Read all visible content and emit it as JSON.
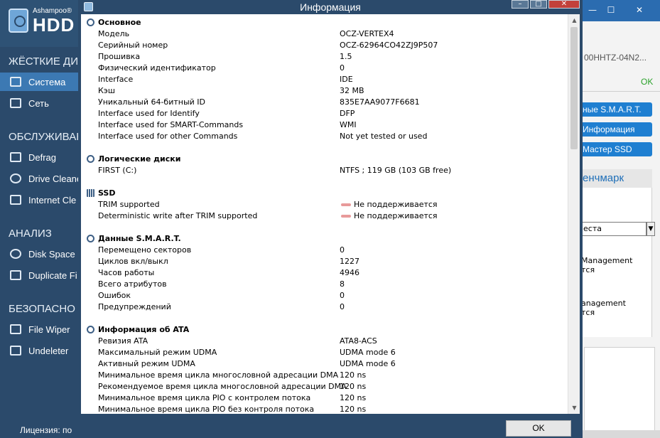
{
  "background": {
    "brand_small": "Ashampoo®",
    "brand_big": "HDD C",
    "sections": [
      {
        "label": "ЖЁСТКИЕ ДИС"
      },
      {
        "label": "ОБСЛУЖИВАН"
      },
      {
        "label": "АНАЛИЗ"
      },
      {
        "label": "БЕЗОПАСНО"
      }
    ],
    "items": [
      {
        "label": "Система",
        "icon": "monitor-icon"
      },
      {
        "label": "Сеть",
        "icon": "network-icon"
      },
      {
        "label": "Defrag",
        "icon": "defrag-icon"
      },
      {
        "label": "Drive Cleane",
        "icon": "drive-cleaner-icon"
      },
      {
        "label": "Internet Cle",
        "icon": "internet-cleaner-icon"
      },
      {
        "label": "Disk Space",
        "icon": "disk-space-icon"
      },
      {
        "label": "Duplicate Fi",
        "icon": "duplicate-icon"
      },
      {
        "label": "File Wiper",
        "icon": "file-wiper-icon"
      },
      {
        "label": "Undeleter",
        "icon": "undeleter-icon"
      }
    ],
    "license": "Лицензия: по",
    "right": {
      "model": "00HHTZ-04N2...",
      "ok": "OK",
      "buttons": [
        "ные S.M.A.R.T.",
        "Информация",
        "Мастер SSD"
      ],
      "bench_header": "енчмарк",
      "select_value": "еста",
      "text1a": "Management",
      "text1b": "тся",
      "text2a": "anagement",
      "text2b": "тся"
    }
  },
  "dialog": {
    "title": "Информация",
    "ok_label": "OK",
    "sections": [
      {
        "title": "Основное",
        "icon": "info-icon",
        "rows": [
          {
            "k": "Модель",
            "v": "OCZ-VERTEX4"
          },
          {
            "k": "Серийный номер",
            "v": "OCZ-62964CO42ZJ9P507"
          },
          {
            "k": "Прошивка",
            "v": "1.5"
          },
          {
            "k": "Физический идентификатор",
            "v": "0"
          },
          {
            "k": "Interface",
            "v": "IDE"
          },
          {
            "k": "Кэш",
            "v": "32 MB"
          },
          {
            "k": "Уникальный 64-битный ID",
            "v": "835E7AA9077F6681"
          },
          {
            "k": "Interface used for Identify",
            "v": "DFP"
          },
          {
            "k": "Interface used for SMART-Commands",
            "v": "WMI"
          },
          {
            "k": "Interface used for other Commands",
            "v": "Not yet tested or used"
          }
        ]
      },
      {
        "title": "Логические диски",
        "icon": "info-icon",
        "rows": [
          {
            "k": "FIRST (C:)",
            "v": "NTFS ; 119 GB (103 GB free)"
          }
        ]
      },
      {
        "title": "SSD",
        "icon": "ssd-icon",
        "rows": [
          {
            "k": "TRIM supported",
            "v": "Не поддерживается",
            "flag": true
          },
          {
            "k": "Deterministic write after TRIM supported",
            "v": "Не поддерживается",
            "flag": true
          }
        ]
      },
      {
        "title": "Данные S.M.A.R.T.",
        "icon": "info-icon",
        "rows": [
          {
            "k": "Перемещено секторов",
            "v": "0"
          },
          {
            "k": "Циклов вкл/выкл",
            "v": "1227"
          },
          {
            "k": "Часов работы",
            "v": "4946"
          },
          {
            "k": "Всего атрибутов",
            "v": "8"
          },
          {
            "k": "Ошибок",
            "v": "0"
          },
          {
            "k": "Предупреждений",
            "v": "0"
          }
        ]
      },
      {
        "title": "Информация об ATA",
        "icon": "info-icon",
        "rows": [
          {
            "k": "Ревизия ATA",
            "v": "ATA8-ACS"
          },
          {
            "k": "Максимальный режим UDMA",
            "v": "UDMA mode 6"
          },
          {
            "k": "Активный режим UDMA",
            "v": "UDMA mode 6"
          },
          {
            "k": "Минимальное время цикла многословной адресации DMA",
            "v": "120 ns"
          },
          {
            "k": "Рекомендуемое время цикла многословной адресации DMA",
            "v": "120 ns"
          },
          {
            "k": "Минимальное время цикла PIO с контролем потока",
            "v": "120 ns"
          },
          {
            "k": "Минимальное время цикла PIO без контроля потока",
            "v": "120 ns"
          }
        ]
      }
    ]
  }
}
